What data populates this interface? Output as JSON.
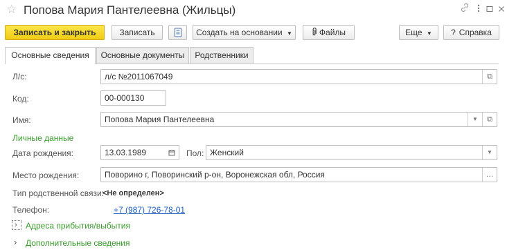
{
  "window": {
    "title": "Попова Мария Пантелеевна (Жильцы)"
  },
  "toolbar": {
    "save_close": "Записать и закрыть",
    "save": "Записать",
    "create_based": "Создать на основании",
    "files": "Файлы",
    "more": "Еще",
    "help": "Справка",
    "help_glyph": "?"
  },
  "tabs": [
    {
      "label": "Основные сведения",
      "active": true
    },
    {
      "label": "Основные документы",
      "active": false
    },
    {
      "label": "Родственники",
      "active": false
    }
  ],
  "form": {
    "account": {
      "label": "Л/с:",
      "value": "л/с №2011067049"
    },
    "code": {
      "label": "Код:",
      "value": "00-000130"
    },
    "name": {
      "label": "Имя:",
      "value": "Попова Мария Пантелеевна"
    },
    "personal_section": "Личные данные",
    "birth_date": {
      "label": "Дата рождения:",
      "value": "13.03.1989"
    },
    "gender": {
      "label": "Пол:",
      "value": "Женский"
    },
    "birth_place": {
      "label": "Место рождения:",
      "value": "Поворино г, Поворинский р-он, Воронежская обл, Россия"
    },
    "relation": {
      "label": "Тип родственной связи:",
      "value": "<Не определен>"
    },
    "phone": {
      "label": "Телефон:",
      "value": "+7 (987) 726-78-01"
    },
    "addresses_section": "Адреса прибытия/выбытия",
    "extra_section": "Дополнительные сведения"
  },
  "colors": {
    "primary_button": "#f1cc14",
    "section_green": "#3a9a2e",
    "link_blue": "#1f5fbf"
  }
}
